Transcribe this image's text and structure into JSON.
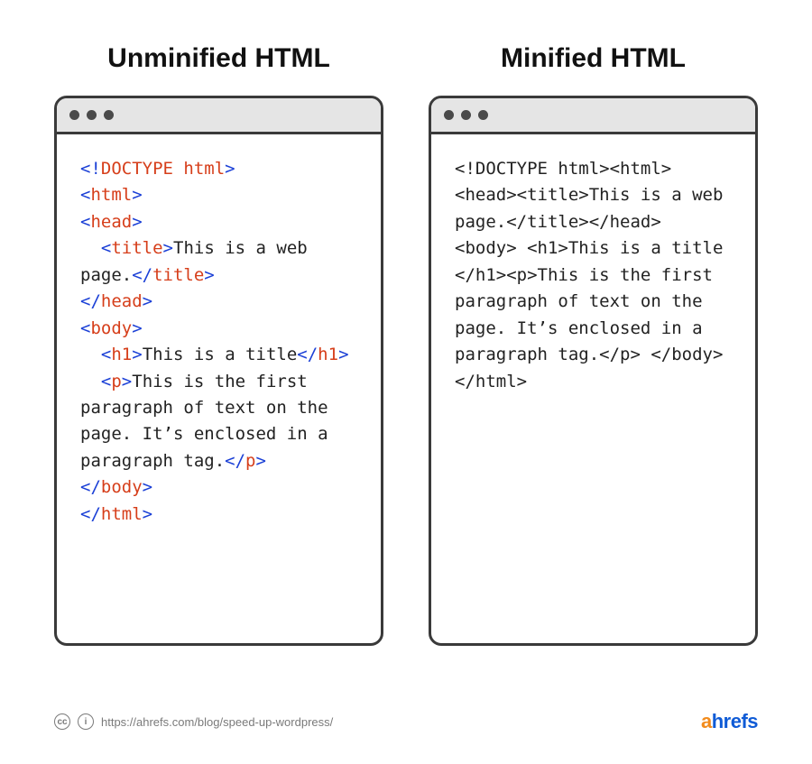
{
  "headings": {
    "left": "Unminified HTML",
    "right": "Minified HTML"
  },
  "unminified": {
    "doctype_open": "<!",
    "doctype_word": "DOCTYPE",
    "doctype_html": " html",
    "doctype_close": ">",
    "html_open_l": "<",
    "html_tag": "html",
    "html_open_r": ">",
    "head_open_l": "<",
    "head_tag": "head",
    "head_open_r": ">",
    "title_open_l": "<",
    "title_tag": "title",
    "title_open_r": ">",
    "title_text": "This is a web page.",
    "title_close_l": "</",
    "title_close_r": ">",
    "head_close_l": "</",
    "head_close_r": ">",
    "body_open_l": "<",
    "body_tag": "body",
    "body_open_r": ">",
    "h1_open_l": "<",
    "h1_tag": "h1",
    "h1_open_r": ">",
    "h1_text": "This is a title",
    "h1_close_l": "</",
    "h1_close_r": ">",
    "p_open_l": "<",
    "p_tag": "p",
    "p_open_r": ">",
    "p_text": "This is the first paragraph of text on the page. It’s enclosed in a paragraph tag.",
    "p_close_l": "</",
    "p_close_r": ">",
    "body_close_l": "</",
    "body_close_r": ">",
    "html_close_l": "</",
    "html_close_r": ">"
  },
  "minified": {
    "text": "<!DOCTYPE html><html> <head><title>This is a web page.</title></head> <body> <h1>This is a title </h1><p>This is the first paragraph of text on the page. It’s enclosed in a paragraph tag.</p> </body></html>"
  },
  "footer": {
    "cc": "cc",
    "by": "i",
    "url": "https://ahrefs.com/blog/speed-up-wordpress/",
    "brand_a": "a",
    "brand_rest": "hrefs"
  }
}
